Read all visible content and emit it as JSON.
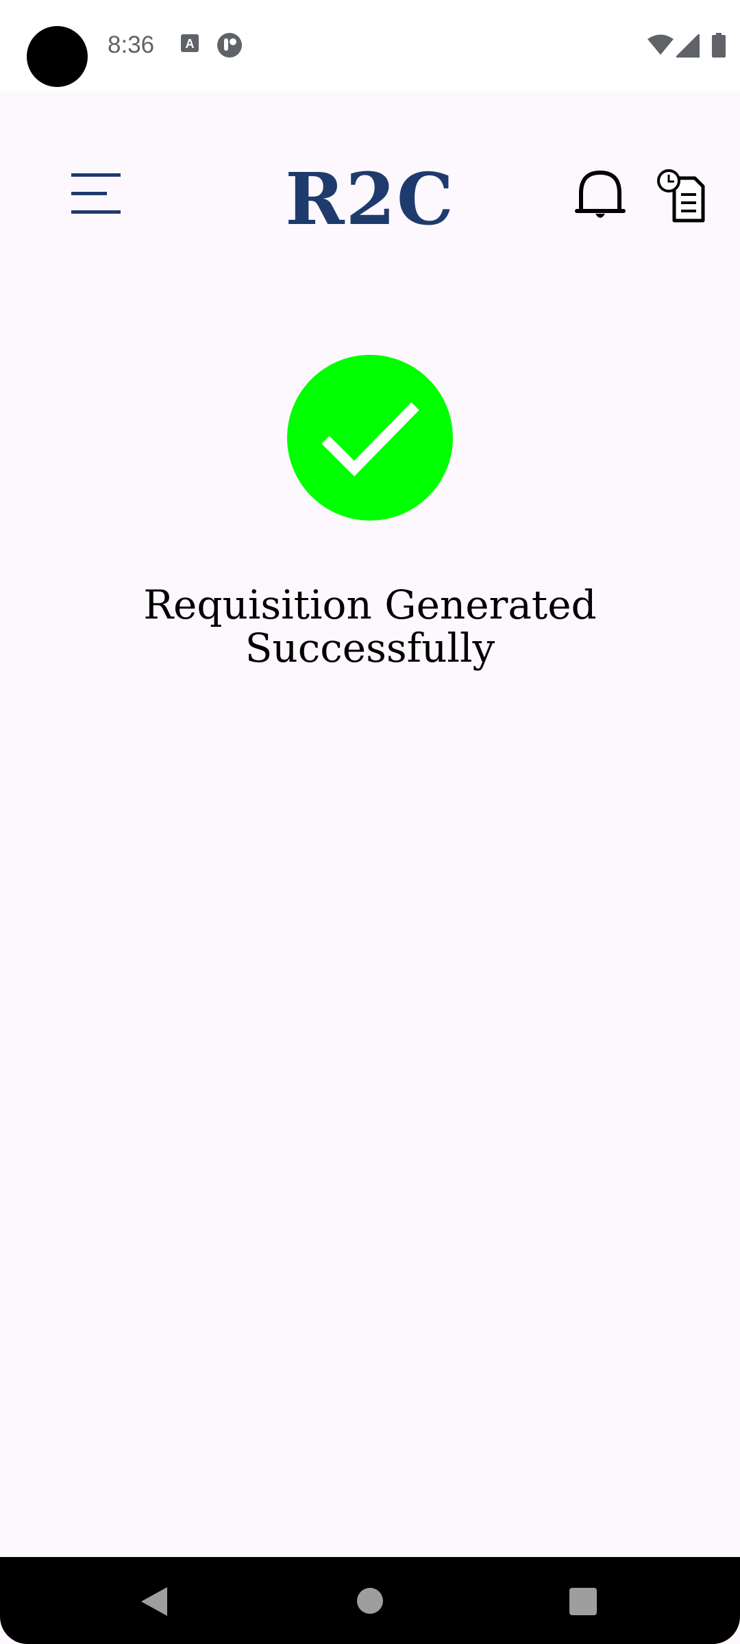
{
  "status_bar": {
    "time": "8:36",
    "notification_icons": [
      "text-recognition-icon",
      "app-notification-icon"
    ],
    "system_icons": [
      "wifi-icon",
      "cellular-signal-icon",
      "battery-icon"
    ]
  },
  "app_bar": {
    "title": "R2C",
    "title_color": "#1F3A6D",
    "menu_icon": "menu-icon",
    "actions": [
      "bell-icon",
      "history-document-icon"
    ]
  },
  "main": {
    "status_icon": "checkmark-icon",
    "status_color": "#00FF00",
    "message_line1": "Requisition Generated",
    "message_line2": "Successfully"
  },
  "nav_bar": {
    "buttons": [
      "back-icon",
      "home-icon",
      "recents-icon"
    ]
  }
}
